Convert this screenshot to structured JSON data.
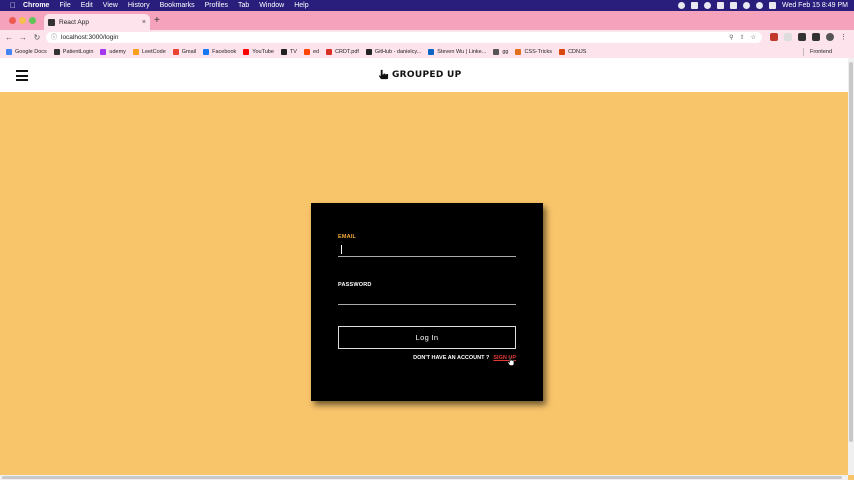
{
  "menubar": {
    "app": "Chrome",
    "items": [
      "File",
      "Edit",
      "View",
      "History",
      "Bookmarks",
      "Profiles",
      "Tab",
      "Window",
      "Help"
    ],
    "clock": "Wed Feb 15  8:49 PM"
  },
  "browser": {
    "tab_title": "React App",
    "tab_close": "×",
    "new_tab": "+",
    "url": "localhost:3000/login",
    "bookmarks": [
      {
        "label": "Google Docs",
        "color": "#4285f4"
      },
      {
        "label": "PatientLogin",
        "color": "#333333"
      },
      {
        "label": "udemy",
        "color": "#a435f0"
      },
      {
        "label": "LeetCode",
        "color": "#f89f1b"
      },
      {
        "label": "Gmail",
        "color": "#ea4335"
      },
      {
        "label": "Facebook",
        "color": "#1877f2"
      },
      {
        "label": "YouTube",
        "color": "#ff0000"
      },
      {
        "label": "TV",
        "color": "#222222"
      },
      {
        "label": "ed",
        "color": "#ff4500"
      },
      {
        "label": "CRDT.pdf",
        "color": "#d93025"
      },
      {
        "label": "GitHub - danielcy...",
        "color": "#222222"
      },
      {
        "label": "Steven Wu | Linke...",
        "color": "#0a66c2"
      },
      {
        "label": "gg",
        "color": "#555555"
      },
      {
        "label": "CSS-Tricks",
        "color": "#e2711d"
      },
      {
        "label": "CDNJS",
        "color": "#d9480f"
      }
    ],
    "bookmarks_other": "Frontend"
  },
  "app": {
    "brand": "GROUPED UP",
    "login": {
      "email_label": "EMAIL",
      "email_value": "",
      "password_label": "PASSWORD",
      "password_value": "",
      "login_button": "Log In",
      "signup_prompt": "DON'T HAVE AN ACCOUNT ?",
      "signup_link": "SIGN UP"
    }
  },
  "colors": {
    "page_background": "#f9c56b",
    "card_background": "#000000",
    "email_label": "#f5a93a",
    "signup_link": "#e53935",
    "tab_strip": "#f5a3bd",
    "menubar": "#2a1e7c"
  }
}
